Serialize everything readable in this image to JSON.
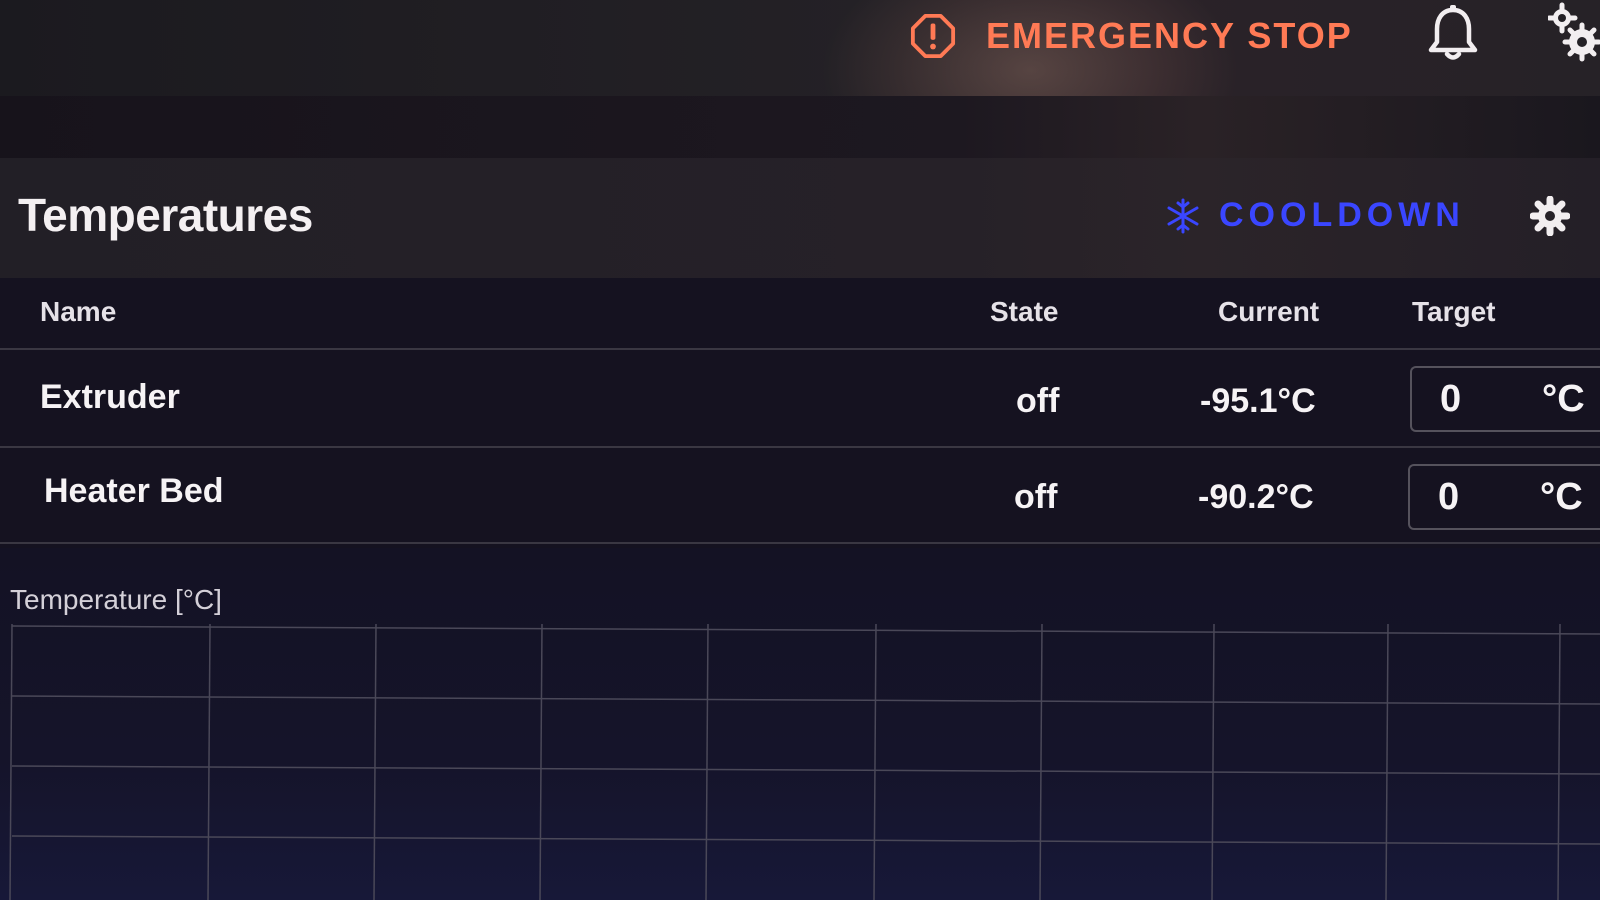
{
  "header": {
    "emergency_stop_label": "EMERGENCY STOP",
    "icons": [
      "alert-octagon-icon",
      "bell-icon",
      "gears-icon"
    ]
  },
  "card": {
    "title": "Temperatures",
    "cooldown_label": "COOLDOWN",
    "icons": [
      "snowflake-icon",
      "gear-icon"
    ]
  },
  "table": {
    "columns": {
      "name": "Name",
      "state": "State",
      "current": "Current",
      "target": "Target"
    },
    "rows": [
      {
        "name": "Extruder",
        "state": "off",
        "current": "-95.1°C",
        "target_value": "0",
        "target_unit": "°C"
      },
      {
        "name": "Heater Bed",
        "state": "off",
        "current": "-90.2°C",
        "target_value": "0",
        "target_unit": "°C"
      }
    ]
  },
  "chart": {
    "ylabel": "Temperature [°C]"
  },
  "colors": {
    "emergency": "#ff7a55",
    "cooldown": "#3a46ff",
    "background": "#14121c"
  }
}
